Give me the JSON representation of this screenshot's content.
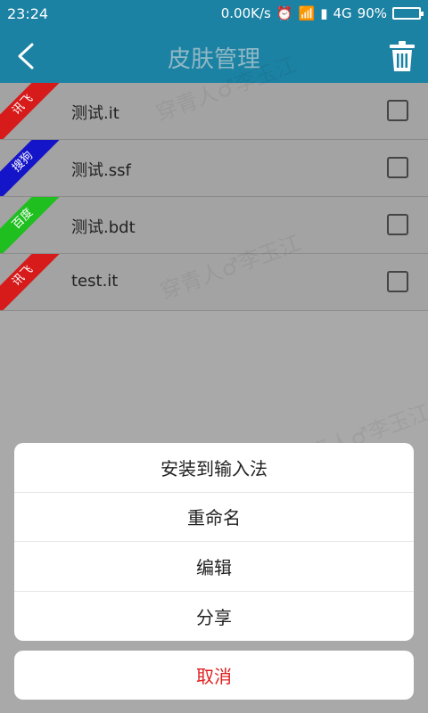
{
  "status": {
    "time": "23:24",
    "speed": "0.00K/s",
    "network": "4G",
    "battery": "90%",
    "battery_level": 0.9
  },
  "header": {
    "title": "皮肤管理"
  },
  "skins": [
    {
      "tag": "讯飞",
      "tag_color": "#d71b1b",
      "label": "测试.it"
    },
    {
      "tag": "搜狗",
      "tag_color": "#1414c8",
      "label": "测试.ssf"
    },
    {
      "tag": "百度",
      "tag_color": "#1fbf1f",
      "label": "测试.bdt"
    },
    {
      "tag": "讯飞",
      "tag_color": "#d71b1b",
      "label": "test.it"
    }
  ],
  "sheet": {
    "items": [
      "安装到输入法",
      "重命名",
      "编辑",
      "分享"
    ],
    "cancel": "取消",
    "cancel_color": "#e02020"
  },
  "watermark": "穿青人♂李玉江"
}
